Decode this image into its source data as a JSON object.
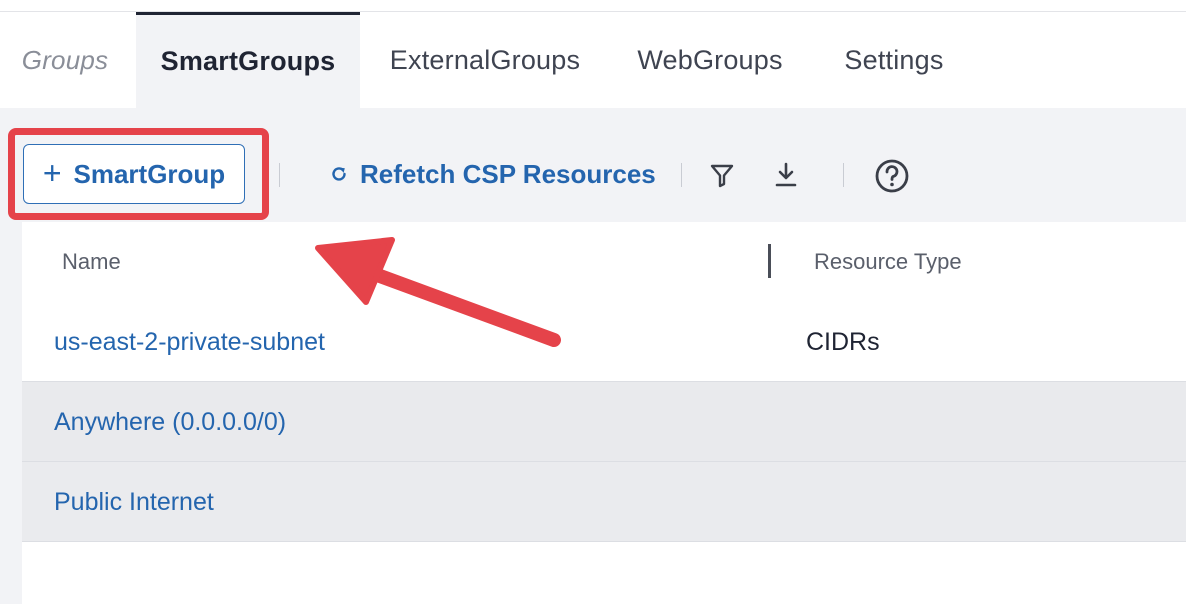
{
  "tabs": [
    {
      "label": "Groups"
    },
    {
      "label": "SmartGroups"
    },
    {
      "label": "ExternalGroups"
    },
    {
      "label": "WebGroups"
    },
    {
      "label": "Settings"
    }
  ],
  "toolbar": {
    "add_button": {
      "icon": "plus-icon",
      "label": "SmartGroup"
    },
    "refetch": {
      "icon": "refresh-icon",
      "label": "Refetch CSP Resources"
    },
    "icons": [
      "filter-icon",
      "download-icon",
      "help-icon"
    ]
  },
  "table": {
    "columns": [
      "Name",
      "Resource Type"
    ],
    "rows": [
      {
        "name": "us-east-2-private-subnet",
        "type": "CIDRs"
      },
      {
        "name": "Anywhere (0.0.0.0/0)",
        "type": ""
      },
      {
        "name": "Public Internet",
        "type": ""
      }
    ]
  },
  "annotation": {
    "color": "#e5434a"
  },
  "colors": {
    "accent": "#2465ae",
    "tab_active": "#1f2433",
    "toolbar_bg": "#f2f3f6"
  }
}
